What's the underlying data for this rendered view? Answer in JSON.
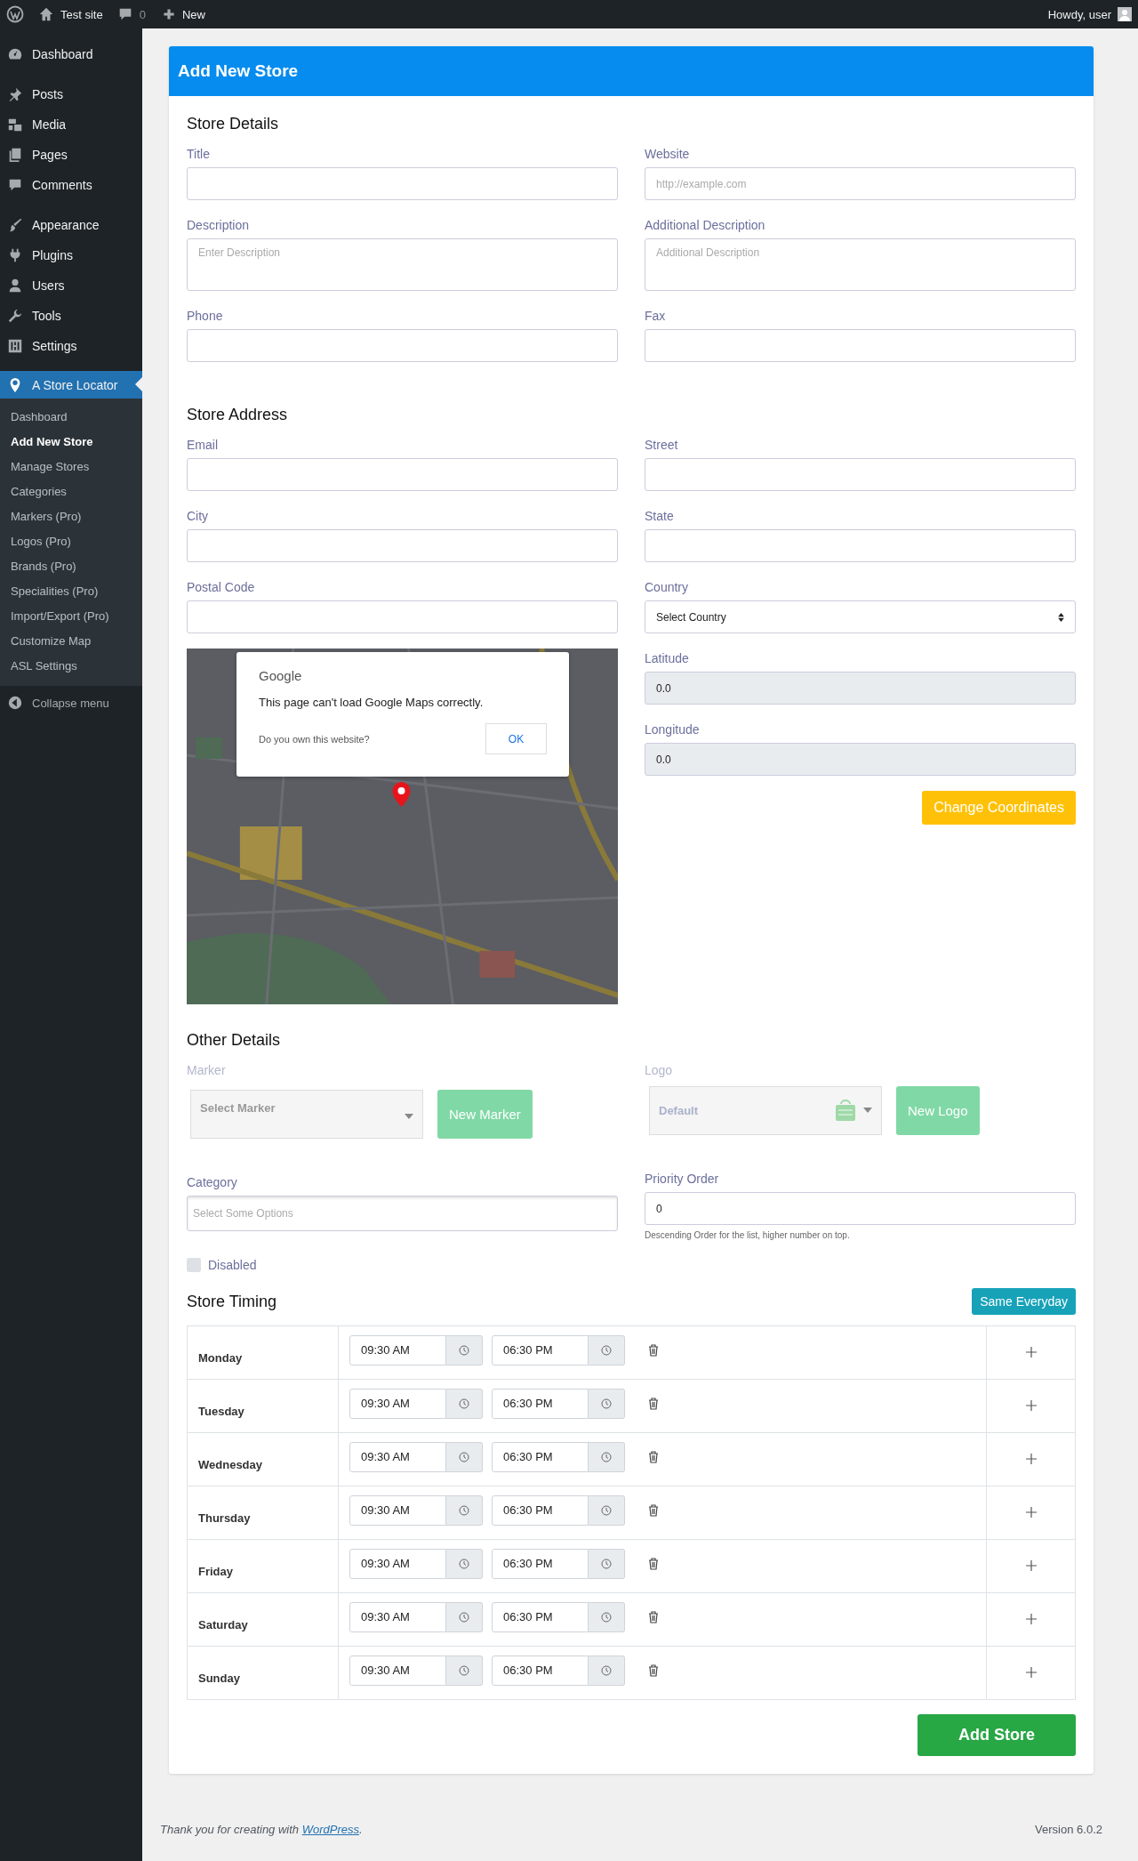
{
  "admin_bar": {
    "site": "Test site",
    "comments": "0",
    "new": "New",
    "greeting": "Howdy, user"
  },
  "sidebar": {
    "groups": [
      {
        "items": [
          {
            "label": "Dashboard",
            "selected": false
          }
        ]
      },
      {
        "items": [
          {
            "label": "Posts",
            "selected": false
          },
          {
            "label": "Media",
            "selected": false
          },
          {
            "label": "Pages",
            "selected": false
          },
          {
            "label": "Comments",
            "selected": false
          }
        ]
      },
      {
        "items": [
          {
            "label": "Appearance",
            "selected": false
          },
          {
            "label": "Plugins",
            "selected": false
          },
          {
            "label": "Users",
            "selected": false
          },
          {
            "label": "Tools",
            "selected": false
          },
          {
            "label": "Settings",
            "selected": false
          }
        ]
      },
      {
        "items": [
          {
            "label": "A Store Locator",
            "selected": true
          }
        ]
      }
    ],
    "submenu": [
      {
        "label": "Dashboard",
        "selected": false
      },
      {
        "label": "Add New Store",
        "selected": true
      },
      {
        "label": "Manage Stores",
        "selected": false
      },
      {
        "label": "Categories",
        "selected": false
      },
      {
        "label": "Markers (Pro)",
        "selected": false
      },
      {
        "label": "Logos (Pro)",
        "selected": false
      },
      {
        "label": "Brands (Pro)",
        "selected": false
      },
      {
        "label": "Specialities (Pro)",
        "selected": false
      },
      {
        "label": "Import/Export (Pro)",
        "selected": false
      },
      {
        "label": "Customize Map",
        "selected": false
      },
      {
        "label": "ASL Settings",
        "selected": false
      }
    ],
    "collapse": "Collapse menu"
  },
  "page_title": "Add New Store",
  "store_details": {
    "heading": "Store Details",
    "left": [
      {
        "kind": "input",
        "label": "Title"
      },
      {
        "kind": "textarea",
        "label": "Description",
        "placeholder": "Enter Description"
      },
      {
        "kind": "input",
        "label": "Phone"
      }
    ],
    "right": [
      {
        "kind": "input",
        "label": "Website",
        "placeholder": "http://example.com"
      },
      {
        "kind": "textarea",
        "label": "Additional Description",
        "placeholder": "Additional Description"
      },
      {
        "kind": "input",
        "label": "Fax"
      }
    ]
  },
  "store_address": {
    "heading": "Store Address",
    "left": [
      {
        "kind": "input",
        "label": "Email"
      },
      {
        "kind": "input",
        "label": "City"
      },
      {
        "kind": "input",
        "label": "Postal Code"
      },
      {
        "kind": "map"
      }
    ],
    "right": [
      {
        "kind": "input",
        "label": "Street"
      },
      {
        "kind": "input",
        "label": "State"
      },
      {
        "kind": "select",
        "label": "Country",
        "value": "Select Country"
      },
      {
        "kind": "readonly",
        "label": "Latitude",
        "value": "0.0"
      },
      {
        "kind": "readonly",
        "label": "Longitude",
        "value": "0.0"
      },
      {
        "kind": "button",
        "label": "Change Coordinates"
      }
    ],
    "map_dialog": {
      "brand": "Google",
      "message": "This page can't load Google Maps correctly.",
      "question": "Do you own this website?",
      "button": "OK"
    }
  },
  "other_details": {
    "heading": "Other Details",
    "marker": {
      "label": "Marker",
      "value": "Select Marker",
      "button": "New Marker"
    },
    "logo": {
      "label": "Logo",
      "value": "Default",
      "button": "New Logo"
    },
    "category": {
      "label": "Category",
      "placeholder": "Select Some Options"
    },
    "priority": {
      "label": "Priority Order",
      "value": "0",
      "help": "Descending Order for the list, higher number on top."
    },
    "disabled": {
      "label": "Disabled",
      "checked": false
    }
  },
  "store_timing": {
    "heading": "Store Timing",
    "button": "Same Everyday",
    "days": [
      {
        "name": "Monday",
        "open": "09:30 AM",
        "close": "06:30 PM"
      },
      {
        "name": "Tuesday",
        "open": "09:30 AM",
        "close": "06:30 PM"
      },
      {
        "name": "Wednesday",
        "open": "09:30 AM",
        "close": "06:30 PM"
      },
      {
        "name": "Thursday",
        "open": "09:30 AM",
        "close": "06:30 PM"
      },
      {
        "name": "Friday",
        "open": "09:30 AM",
        "close": "06:30 PM"
      },
      {
        "name": "Saturday",
        "open": "09:30 AM",
        "close": "06:30 PM"
      },
      {
        "name": "Sunday",
        "open": "09:30 AM",
        "close": "06:30 PM"
      }
    ]
  },
  "submit": "Add Store",
  "footer": {
    "text_before": "Thank you for creating with ",
    "link": "WordPress",
    "text_after": ".",
    "version": "Version 6.0.2"
  }
}
